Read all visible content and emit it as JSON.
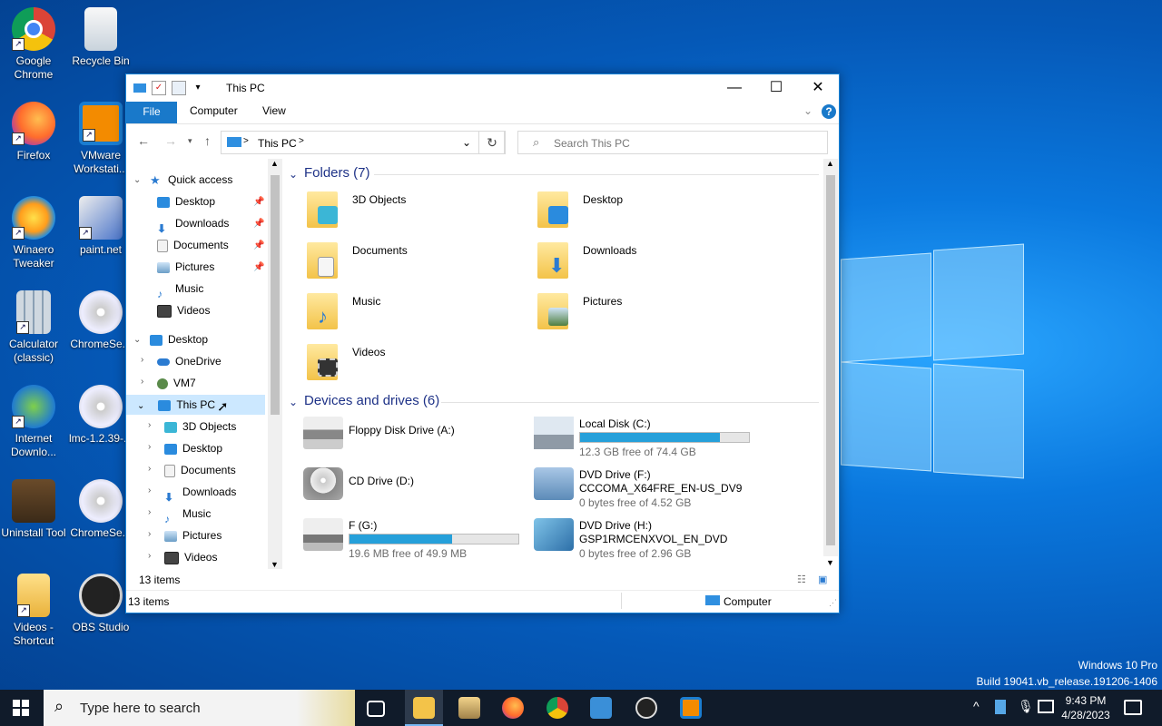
{
  "desktop": {
    "icons": [
      {
        "label": "Google Chrome",
        "icon": "chrome-icon"
      },
      {
        "label": "Recycle Bin",
        "icon": "recycle-bin-icon"
      },
      {
        "label": "Firefox",
        "icon": "firefox-icon"
      },
      {
        "label": "VMware Workstati...",
        "icon": "vmware-icon"
      },
      {
        "label": "Winaero Tweaker",
        "icon": "winaero-icon"
      },
      {
        "label": "paint.net",
        "icon": "paintnet-icon"
      },
      {
        "label": "Calculator (classic)",
        "icon": "calculator-icon"
      },
      {
        "label": "ChromeSe...",
        "icon": "disc-icon"
      },
      {
        "label": "Internet Downlo...",
        "icon": "idm-icon"
      },
      {
        "label": "lmc-1.2.39-...",
        "icon": "disc-icon"
      },
      {
        "label": "Uninstall Tool",
        "icon": "uninstall-tool-icon"
      },
      {
        "label": "ChromeSe...",
        "icon": "disc-icon"
      },
      {
        "label": "Videos - Shortcut",
        "icon": "videos-folder-icon"
      },
      {
        "label": "OBS Studio",
        "icon": "obs-icon"
      }
    ],
    "watermark": {
      "line1": "Windows 10 Pro",
      "line2": "Build 19041.vb_release.191206-1406"
    }
  },
  "window": {
    "title": "This PC",
    "ribbon": {
      "file": "File",
      "computer": "Computer",
      "view": "View",
      "help": "?"
    },
    "address": {
      "path": "This PC",
      "sep": ">"
    },
    "search_placeholder": "Search This PC",
    "nav": {
      "quick_access": "Quick access",
      "qa_items": [
        "Desktop",
        "Downloads",
        "Documents",
        "Pictures",
        "Music",
        "Videos"
      ],
      "desktop": "Desktop",
      "onedrive": "OneDrive",
      "vm7": "VM7",
      "this_pc": "This PC",
      "pc_items": [
        "3D Objects",
        "Desktop",
        "Documents",
        "Downloads",
        "Music",
        "Pictures",
        "Videos"
      ]
    },
    "folders_header": "Folders (7)",
    "folders": [
      "3D Objects",
      "Desktop",
      "Documents",
      "Downloads",
      "Music",
      "Pictures",
      "Videos"
    ],
    "devices_header": "Devices and drives (6)",
    "drives": [
      {
        "name": "Floppy Disk Drive (A:)",
        "label2": "",
        "free": ""
      },
      {
        "name": "Local Disk (C:)",
        "label2": "",
        "free": "12.3 GB free of 74.4 GB",
        "used_fraction": 0.83
      },
      {
        "name": "CD Drive (D:)",
        "label2": "",
        "free": ""
      },
      {
        "name": "DVD Drive (F:)",
        "label2": "CCCOMA_X64FRE_EN-US_DV9",
        "free": "0 bytes free of 4.52 GB"
      },
      {
        "name": "F (G:)",
        "label2": "",
        "free": "19.6 MB free of 49.9 MB",
        "used_fraction": 0.61
      },
      {
        "name": "DVD Drive (H:)",
        "label2": "GSP1RMCENXVOL_EN_DVD",
        "free": "0 bytes free of 2.96 GB"
      }
    ],
    "pane_count": "13 items",
    "status": {
      "items": "13 items",
      "computer": "Computer"
    }
  },
  "taskbar": {
    "search_placeholder": "Type here to search",
    "time": "9:43 PM",
    "date": "4/28/2023"
  }
}
